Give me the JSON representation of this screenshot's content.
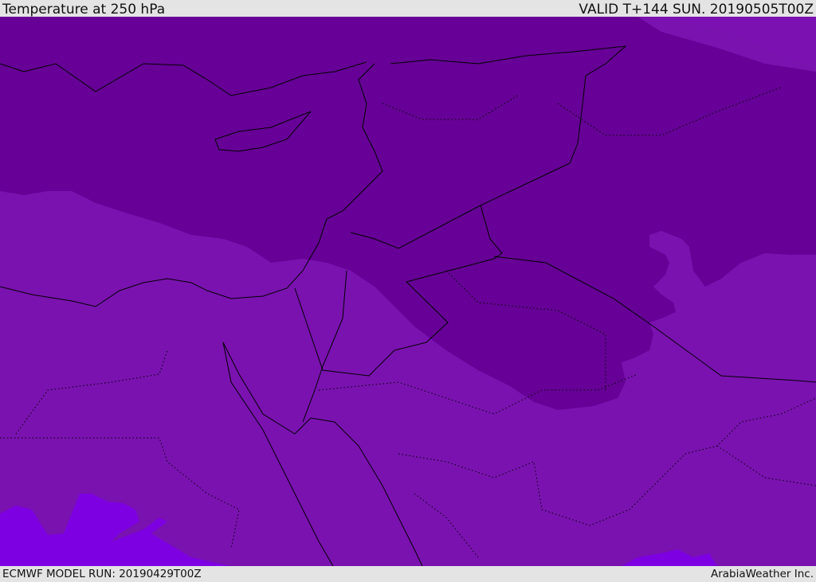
{
  "header": {
    "title": "Temperature at 250 hPa",
    "valid": "VALID T+144 SUN. 20190505T00Z"
  },
  "footer": {
    "model_run": "ECMWF MODEL RUN: 20190429T00Z",
    "credit": "ArabiaWeather Inc."
  },
  "colors": {
    "cold_dark": "#660096",
    "mid": "#7a12b0",
    "warm_bright": "#7d00e2",
    "border": "#000000"
  }
}
